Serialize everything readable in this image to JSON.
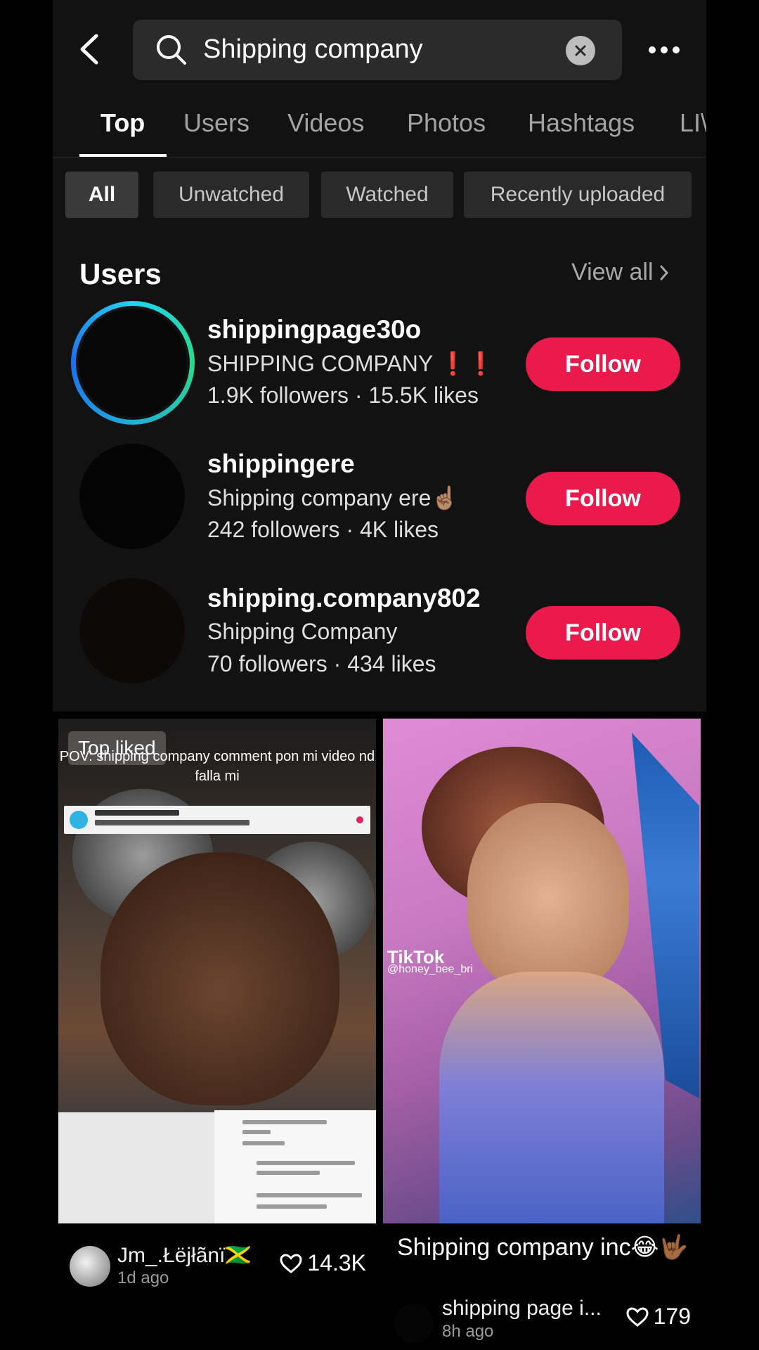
{
  "search": {
    "query": "Shipping company"
  },
  "tabs": [
    {
      "label": "Top"
    },
    {
      "label": "Users"
    },
    {
      "label": "Videos"
    },
    {
      "label": "Photos"
    },
    {
      "label": "Hashtags"
    },
    {
      "label": "LI\\"
    }
  ],
  "filters": [
    {
      "label": "All"
    },
    {
      "label": "Unwatched"
    },
    {
      "label": "Watched"
    },
    {
      "label": "Recently uploaded"
    }
  ],
  "users_section": {
    "title": "Users",
    "view_all": "View all",
    "users": [
      {
        "username": "shippingpage30o",
        "bio": "SHIPPING COMPANY",
        "bio_emoji": "❗❗",
        "stats": "1.9K followers · 15.5K likes",
        "follow": "Follow"
      },
      {
        "username": "shippingere",
        "bio": "Shipping company ere",
        "bio_emoji": "☝🏽",
        "stats": "242 followers · 4K likes",
        "follow": "Follow"
      },
      {
        "username": "shipping.company802",
        "bio": "Shipping Company",
        "bio_emoji": "",
        "stats": "70 followers · 434 likes",
        "follow": "Follow"
      }
    ]
  },
  "videos": [
    {
      "badge": "Top liked",
      "overlay_text": "POV: shipping company comment pon mi video nd falla mi",
      "author": "Jm_.Łëjłãnï🇯🇲",
      "time": "1d ago",
      "likes": "14.3K"
    },
    {
      "watermark_brand": "TikTok",
      "watermark_handle": "@honey_bee_bri",
      "caption": "Shipping company inc😂🤟🏾",
      "author": "shipping page i...",
      "time": "8h ago",
      "likes": "179"
    }
  ],
  "colors": {
    "follow": "#ea1a4d",
    "background": "#121212",
    "chip": "#2a2a2a"
  },
  "icons": [
    "back-chevron-icon",
    "search-icon",
    "clear-icon",
    "more-icon",
    "chevron-right-icon",
    "heart-icon"
  ]
}
